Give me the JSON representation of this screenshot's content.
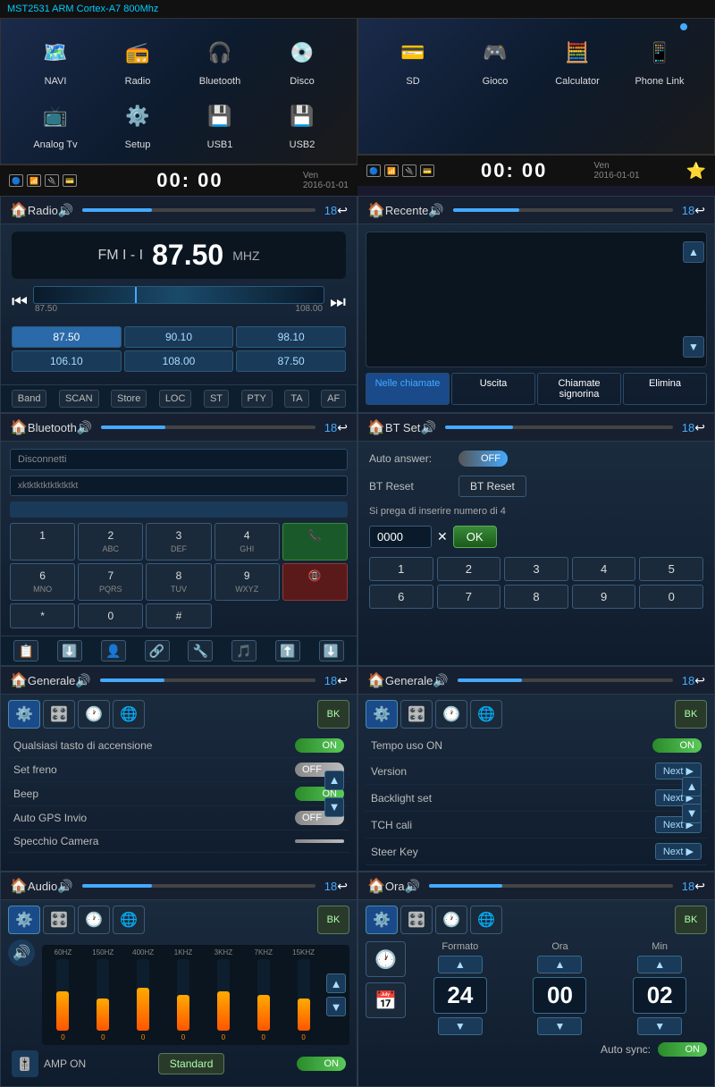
{
  "header": {
    "title": "MST2531 ARM Cortex-A7 800Mhz"
  },
  "panel1": {
    "apps_row1": [
      {
        "icon": "🗺️",
        "label": "NAVI"
      },
      {
        "icon": "📻",
        "label": "Radio"
      },
      {
        "icon": "🎧",
        "label": "Bluetooth"
      },
      {
        "icon": "💿",
        "label": "Disco"
      }
    ],
    "apps_row2": [
      {
        "icon": "📺",
        "label": "Analog Tv"
      },
      {
        "icon": "⚙️",
        "label": "Setup"
      },
      {
        "icon": "💾",
        "label": "USB1"
      },
      {
        "icon": "💾",
        "label": "USB2"
      }
    ],
    "status": {
      "time": "00: 00",
      "date": "2016-01-01",
      "day": "Ven"
    }
  },
  "panel2": {
    "apps_row1": [
      {
        "icon": "💳",
        "label": "SD"
      },
      {
        "icon": "🎮",
        "label": "Gioco"
      },
      {
        "icon": "🧮",
        "label": "Calculator"
      },
      {
        "icon": "📱",
        "label": "Phone Link"
      }
    ],
    "status": {
      "time": "00: 00",
      "date": "2016-01-01",
      "day": "Ven"
    }
  },
  "radio": {
    "title": "Radio",
    "volume": 18,
    "band": "FM I - I",
    "freq": "87.50",
    "unit": "MHZ",
    "range_min": "87.50",
    "range_max": "108.00",
    "presets": [
      "87.50",
      "90.10",
      "98.10",
      "106.10",
      "108.00",
      "87.50"
    ],
    "controls": [
      "Band",
      "SCAN",
      "Store",
      "LOC",
      "ST",
      "PTY",
      "TA",
      "AF"
    ]
  },
  "recente": {
    "title": "Recente",
    "volume": 18,
    "tabs": [
      "Nelle chiamate",
      "Uscita",
      "Chiamate signorina",
      "Elimina"
    ]
  },
  "bluetooth": {
    "title": "Bluetooth",
    "volume": 18,
    "device": "Disconnetti",
    "device_id": "xktktktktktktktkt",
    "numpad": [
      "1",
      "2",
      "3",
      "4",
      "☎"
    ],
    "numpad2": [
      "6",
      "7",
      "8",
      "9",
      "0",
      "#"
    ],
    "bottom_icons": [
      "📋",
      "⬇️",
      "👤",
      "🔗",
      "🔧",
      "🎵",
      "⬆️"
    ]
  },
  "btset": {
    "title": "BT Set",
    "volume": 18,
    "auto_answer_label": "Auto answer:",
    "auto_answer": "OFF",
    "bt_reset_label": "BT Reset",
    "bt_reset_btn": "BT Reset",
    "hint": "Si prega di inserire numero di 4",
    "pin": "0000",
    "numpad_row1": [
      "1",
      "2",
      "3",
      "4",
      "5"
    ],
    "numpad_row2": [
      "6",
      "7",
      "8",
      "9",
      "0"
    ]
  },
  "generale1": {
    "title": "Generale",
    "volume": 18,
    "tabs": [
      "⚙️",
      "🎛️",
      "🕐",
      "🌐",
      "BK"
    ],
    "rows": [
      {
        "label": "Qualsiasi tasto di accensione",
        "value": "ON",
        "on": true
      },
      {
        "label": "Set freno",
        "value": "OFF",
        "on": false
      },
      {
        "label": "Beep",
        "value": "ON",
        "on": true
      },
      {
        "label": "Auto GPS Invio",
        "value": "OFF",
        "on": false
      },
      {
        "label": "Specchio Camera",
        "value": "",
        "on": false
      }
    ]
  },
  "generale2": {
    "title": "Generale",
    "volume": 18,
    "rows": [
      {
        "label": "Tempo uso ON",
        "value": "ON",
        "on": true
      },
      {
        "label": "Version",
        "value": "Next"
      },
      {
        "label": "Backlight set",
        "value": "Next"
      },
      {
        "label": "TCH cali",
        "value": "Next"
      },
      {
        "label": "Steer Key",
        "value": "Next"
      }
    ]
  },
  "audio": {
    "title": "Audio",
    "volume": 18,
    "eq_bands": [
      {
        "label": "60HZ",
        "height": 55,
        "val": "0"
      },
      {
        "label": "150HZ",
        "height": 45,
        "val": "0"
      },
      {
        "label": "400HZ",
        "height": 60,
        "val": "0"
      },
      {
        "label": "1KHZ",
        "height": 50,
        "val": "0"
      },
      {
        "label": "3KHZ",
        "height": 55,
        "val": "0"
      },
      {
        "label": "7KHZ",
        "height": 50,
        "val": "0"
      },
      {
        "label": "15KHZ",
        "height": 45,
        "val": "0"
      }
    ],
    "amp_label": "AMP ON",
    "amp_on": "ON",
    "standard": "Standard"
  },
  "ora": {
    "title": "Ora",
    "volume": 18,
    "formato_label": "Formato",
    "ora_label": "Ora",
    "min_label": "Min",
    "formato_val": "24",
    "ora_val": "00",
    "min_val": "02",
    "auto_sync_label": "Auto sync:",
    "auto_sync": "ON"
  },
  "labels": {
    "next": "Next ▶",
    "on": "ON",
    "off": "OFF",
    "ok": "OK",
    "band": "Band",
    "scan": "SCAN",
    "store": "Store",
    "loc": "LOC",
    "st": "ST",
    "pty": "PTY",
    "ta": "TA",
    "af": "AF"
  }
}
